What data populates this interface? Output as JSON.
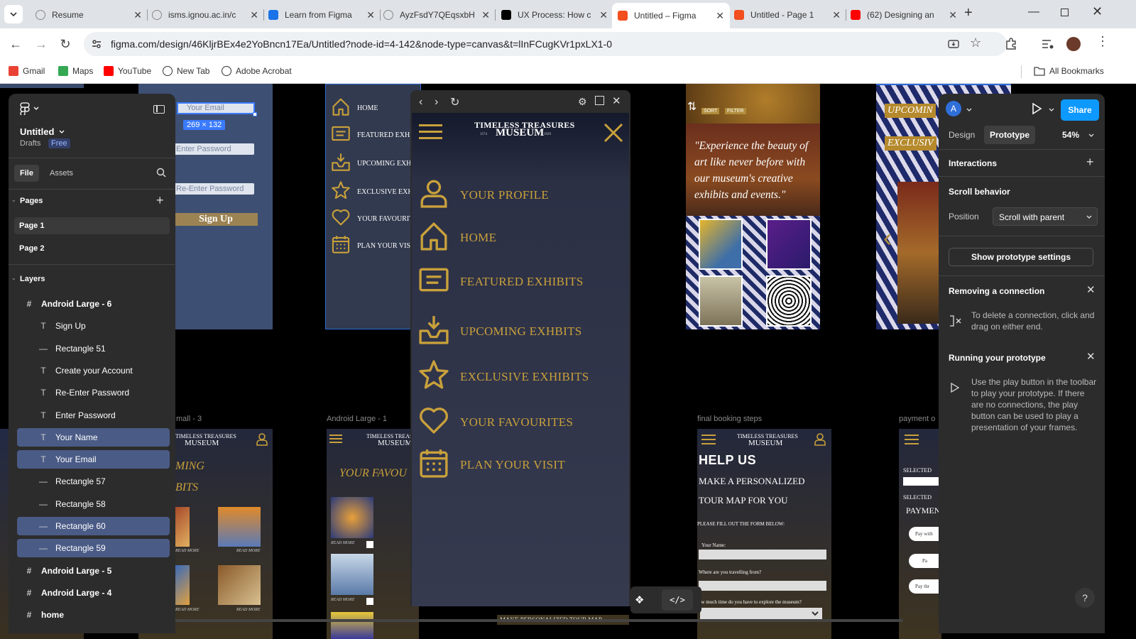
{
  "browser": {
    "tabs": [
      {
        "title": "Resume",
        "icon": "globe-icon",
        "color": "#888888"
      },
      {
        "title": "isms.ignou.ac.in/c",
        "icon": "globe-icon",
        "color": "#888888"
      },
      {
        "title": "Learn from Figma",
        "icon": "chrome-icon",
        "color": "#1a73e8"
      },
      {
        "title": "AyzFsdY7QEqsxbH",
        "icon": "globe-icon",
        "color": "#888888"
      },
      {
        "title": "UX Process: How c",
        "icon": "medium-icon",
        "color": "#000000"
      },
      {
        "title": "Untitled – Figma",
        "icon": "figma-icon",
        "color": "#f24e1e",
        "active": true
      },
      {
        "title": "Untitled - Page 1",
        "icon": "figma-icon",
        "color": "#f24e1e"
      },
      {
        "title": "(62) Designing an",
        "icon": "youtube-icon",
        "color": "#ff0000"
      }
    ],
    "new_tab_symbol": "+",
    "url": "figma.com/design/46KljrBEx4e2YoBncn17Ea/Untitled?node-id=4-142&node-type=canvas&t=lInFCugKVr1pxLX1-0",
    "bookmarks": [
      {
        "label": "Gmail",
        "icon": "gmail-icon",
        "color": "#ea4335"
      },
      {
        "label": "Maps",
        "icon": "maps-icon",
        "color": "#34a853"
      },
      {
        "label": "YouTube",
        "icon": "youtube-icon",
        "color": "#ff0000"
      },
      {
        "label": "New Tab",
        "icon": "globe-icon",
        "color": "#333333"
      },
      {
        "label": "Adobe Acrobat",
        "icon": "globe-icon",
        "color": "#333333"
      }
    ],
    "all_bookmarks": "All Bookmarks"
  },
  "left_panel": {
    "file_name": "Untitled",
    "drafts": "Drafts",
    "plan_badge": "Free",
    "tab_file": "File",
    "tab_assets": "Assets",
    "pages_heading": "Pages",
    "pages": [
      "Page 1",
      "Page 2"
    ],
    "layers_heading": "Layers",
    "layers": [
      {
        "name": "Android Large - 6",
        "type": "frame",
        "indent": 0,
        "selected": false
      },
      {
        "name": "Sign Up",
        "type": "text",
        "indent": 1,
        "selected": false
      },
      {
        "name": "Rectangle 51",
        "type": "rect",
        "indent": 1,
        "selected": false
      },
      {
        "name": "Create your Account",
        "type": "text",
        "indent": 1,
        "selected": false
      },
      {
        "name": "Re-Enter Password",
        "type": "text",
        "indent": 1,
        "selected": false
      },
      {
        "name": "Enter Password",
        "type": "text",
        "indent": 1,
        "selected": false
      },
      {
        "name": "Your Name",
        "type": "text",
        "indent": 1,
        "selected": true
      },
      {
        "name": "Your Email",
        "type": "text",
        "indent": 1,
        "selected": true
      },
      {
        "name": "Rectangle 57",
        "type": "rect",
        "indent": 1,
        "selected": false
      },
      {
        "name": "Rectangle 58",
        "type": "rect",
        "indent": 1,
        "selected": false
      },
      {
        "name": "Rectangle 60",
        "type": "rect",
        "indent": 1,
        "selected": true
      },
      {
        "name": "Rectangle 59",
        "type": "rect",
        "indent": 1,
        "selected": true
      },
      {
        "name": "Android Large - 5",
        "type": "frame",
        "indent": 0,
        "selected": false
      },
      {
        "name": "Android Large - 4",
        "type": "frame",
        "indent": 0,
        "selected": false
      },
      {
        "name": "home",
        "type": "frame",
        "indent": 0,
        "selected": false
      }
    ]
  },
  "canvas": {
    "signup_frame": {
      "email_placeholder": "Your Email",
      "size_badge": "269 × 132",
      "password_placeholder": "Enter Password",
      "reenter_placeholder": "Re-Enter Password",
      "signup_button": "Sign Up"
    },
    "menu_frame_small": [
      "HOME",
      "FEATURED EXHI",
      "UPCOMING EXHI",
      "EXCLUSIVE EXH",
      "YOUR FAVOURIT",
      "PLAN YOUR VISI"
    ],
    "gallery_frame": {
      "sort": "SORT",
      "filter": "FILTER",
      "quote": "\"Experience the beauty of art like never before with our museum's creative exhibits and events.\""
    },
    "right_partial_frame": {
      "line1": "UPCOMIN",
      "line2": "EXCLUSIV"
    },
    "frame_labels": {
      "small3": "mall - 3",
      "android1": "Android Large - 1",
      "booking": "final booking steps",
      "payment": "payment o"
    },
    "logo_top": "TIMELESS TREASURES",
    "logo_bottom": "MUSEUM",
    "logo_years_left": "1574",
    "logo_years_right": "1929",
    "upcoming_title_partial": [
      "MING",
      "BITS"
    ],
    "read_more": "READ MORE",
    "favourites_partial": "YOUR FAVOU",
    "booking": {
      "title": "HELP US",
      "subtitle1": "MAKE A PERSONALIZED",
      "subtitle2": "TOUR MAP FOR YOU",
      "instruction": "PLEASE FILL OUT THE FORM BELOW:",
      "field1": "Your Name:",
      "field2": "Where are you travelling from?",
      "field3": "ow much time do you have to explore the museum?"
    },
    "bottom_partial": "MAKE PERSONALIZED TOUR MAP",
    "payment": {
      "selected1": "SELECTED",
      "selected2": "SELECTED",
      "heading": "PAYMEN",
      "btn1": "Pay with",
      "btn2": "Pa",
      "btn3": "Pay thr"
    }
  },
  "preview": {
    "logo_top": "TIMELESS TREASURES",
    "logo_bottom": "MUSEUM",
    "logo_years_left": "1574",
    "logo_years_right": "1929",
    "menu": [
      {
        "label": "YOUR PROFILE",
        "icon": "profile-icon"
      },
      {
        "label": "HOME",
        "icon": "home-icon"
      },
      {
        "label": "FEATURED EXHIBITS",
        "icon": "featured-icon"
      },
      {
        "label": "UPCOMING EXHBITS",
        "icon": "upcoming-icon"
      },
      {
        "label": "EXCLUSIVE EXHIBITS",
        "icon": "star-icon"
      },
      {
        "label": "YOUR FAVOURITES",
        "icon": "heart-icon"
      },
      {
        "label": "PLAN YOUR VISIT",
        "icon": "calendar-icon"
      }
    ],
    "accent": "#c9a13b"
  },
  "right_panel": {
    "avatar_letter": "A",
    "share": "Share",
    "tab_design": "Design",
    "tab_prototype": "Prototype",
    "zoom": "54%",
    "interactions": "Interactions",
    "scroll_behavior": "Scroll behavior",
    "position_label": "Position",
    "position_value": "Scroll with parent",
    "show_settings": "Show prototype settings",
    "removing_title": "Removing a connection",
    "removing_text": "To delete a connection, click and drag on either end.",
    "running_title": "Running your prototype",
    "running_text": "Use the play button in the toolbar to play your prototype. If there are no connections, the play button can be used to play a presentation of your frames.",
    "help": "?"
  }
}
